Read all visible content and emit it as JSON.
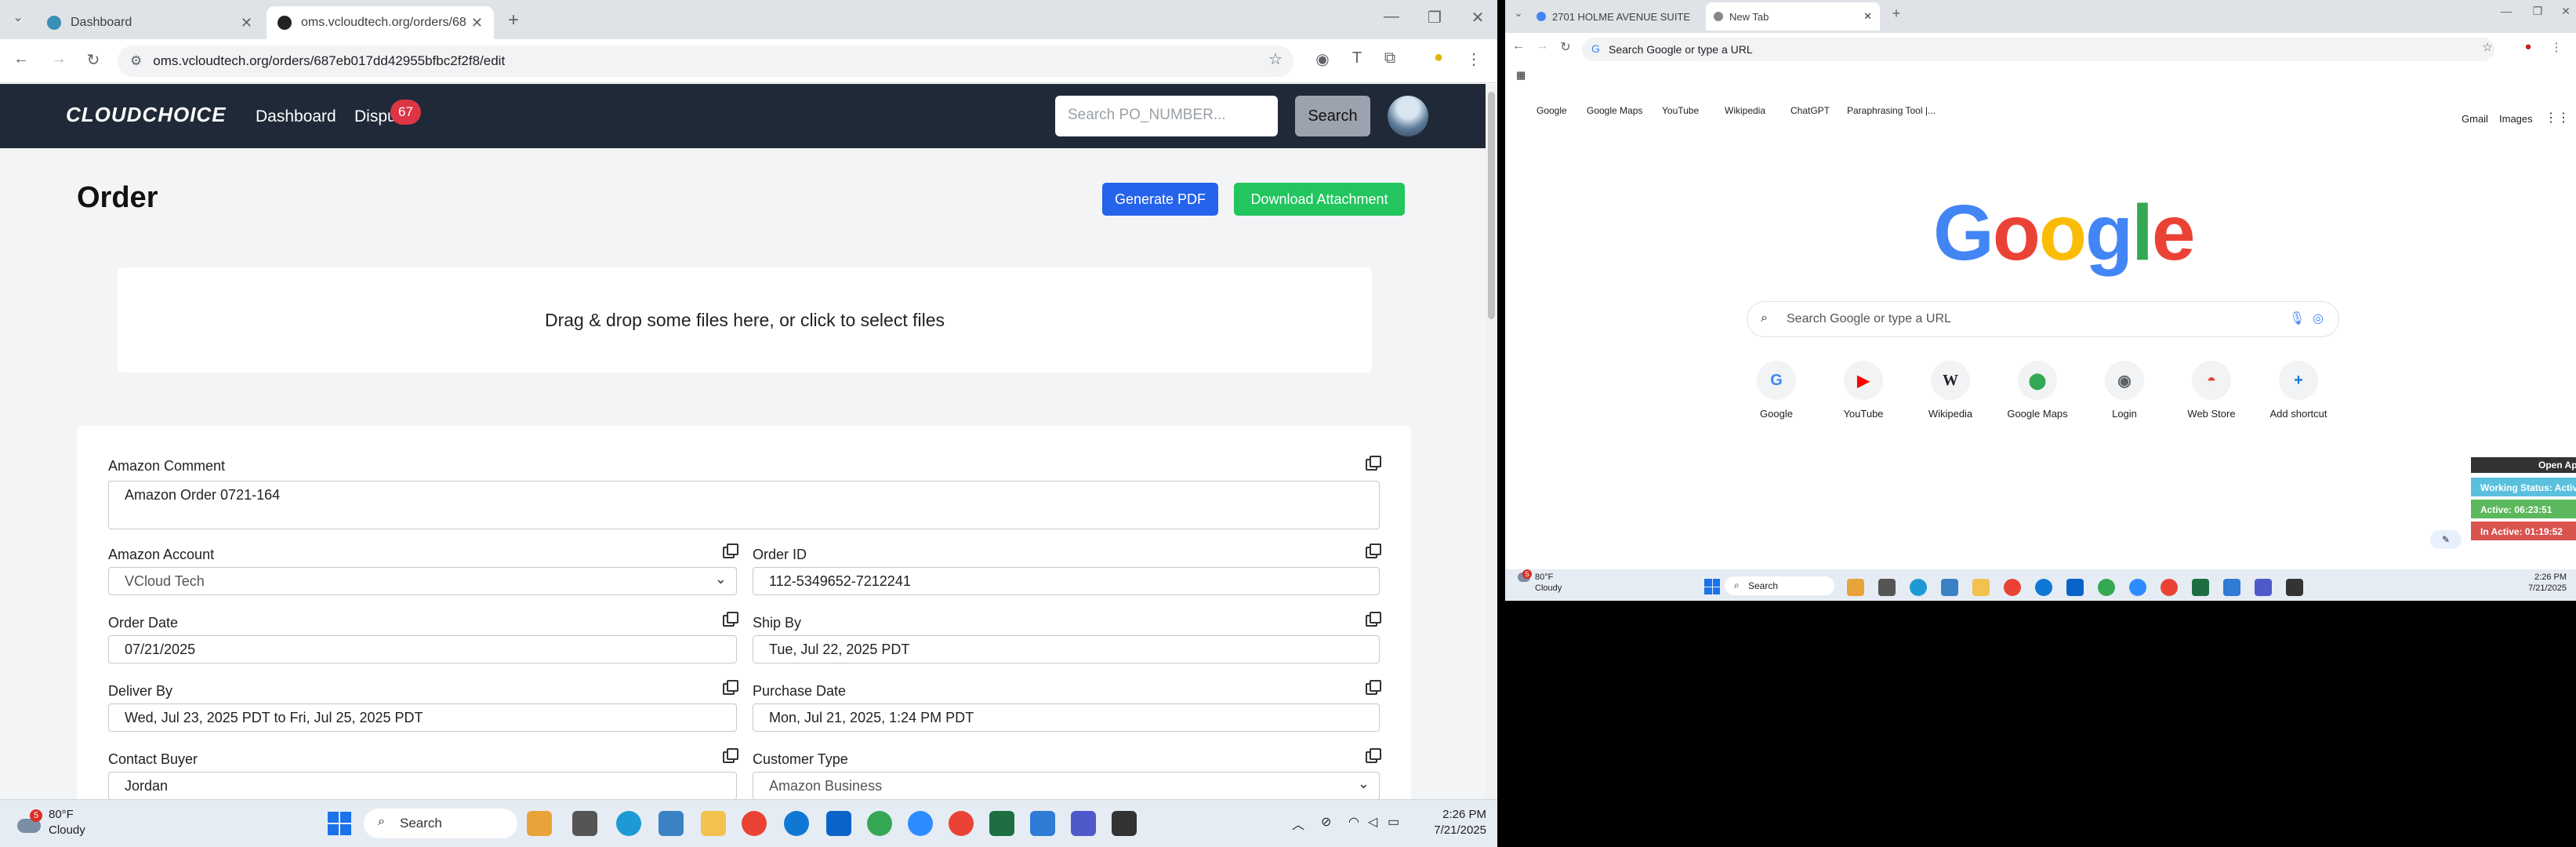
{
  "left_browser": {
    "tabs": [
      {
        "title": "Dashboard"
      },
      {
        "title": "oms.vcloudtech.org/orders/687"
      }
    ],
    "address": "oms.vcloudtech.org/orders/687eb017dd42955bfbc2f2f8/edit"
  },
  "app": {
    "logo": "CLOUDCHOICE",
    "nav": {
      "dashboard": "Dashboard",
      "disputes": "Dispu",
      "disputes_badge": "67"
    },
    "search": {
      "placeholder": "Search PO_NUMBER...",
      "button": "Search"
    },
    "page_title": "Order",
    "buttons": {
      "generate_pdf": "Generate PDF",
      "download_attachment": "Download Attachment"
    },
    "dropzone": "Drag & drop some files here, or click to select files",
    "colors": {
      "navbar": "#1f2937",
      "generate_pdf": "#2563eb",
      "download": "#22c55e"
    },
    "form": {
      "amazon_comment": {
        "label": "Amazon Comment",
        "value": "Amazon Order 0721-164"
      },
      "amazon_account": {
        "label": "Amazon Account",
        "value": "VCloud Tech"
      },
      "order_id": {
        "label": "Order ID",
        "value": "112-5349652-7212241"
      },
      "order_date": {
        "label": "Order Date",
        "value": "07/21/2025"
      },
      "ship_by": {
        "label": "Ship By",
        "value": "Tue, Jul 22, 2025 PDT"
      },
      "deliver_by": {
        "label": "Deliver By",
        "value": "Wed, Jul 23, 2025 PDT to Fri, Jul 25, 2025 PDT"
      },
      "purchase_date": {
        "label": "Purchase Date",
        "value": "Mon, Jul 21, 2025, 1:24 PM PDT"
      },
      "contact_buyer": {
        "label": "Contact Buyer",
        "value": "Jordan"
      },
      "customer_type": {
        "label": "Customer Type",
        "value": "Amazon Business"
      }
    }
  },
  "left_taskbar": {
    "weather": {
      "temp": "80°F",
      "cond": "Cloudy",
      "alert": "5"
    },
    "search": "Search",
    "time": "2:26 PM",
    "date": "7/21/2025"
  },
  "right_browser": {
    "tabs": [
      {
        "title": "2701 HOLME AVENUE SUITE 1..."
      },
      {
        "title": "New Tab"
      }
    ],
    "address": "Search Google or type a URL",
    "bookmarks": [
      "Google",
      "Google Maps",
      "YouTube",
      "Wikipedia",
      "ChatGPT",
      "Paraphrasing Tool |..."
    ],
    "top_links": [
      "Gmail",
      "Images"
    ],
    "logo": "Google",
    "search_placeholder": "Search Google or type a URL",
    "shortcuts": [
      "Google",
      "YouTube",
      "Wikipedia",
      "Google Maps",
      "Login",
      "Web Store",
      "Add shortcut"
    ],
    "overlay": {
      "open": "Open Ap",
      "status": "Working Status: Activ",
      "active": "Active: 06:23:51",
      "inactive": "In Active: 01:19:52"
    }
  },
  "right_taskbar": {
    "weather": {
      "temp": "80°F",
      "cond": "Cloudy",
      "alert": "5"
    },
    "search": "Search",
    "time": "2:26 PM",
    "date": "7/21/2025"
  }
}
